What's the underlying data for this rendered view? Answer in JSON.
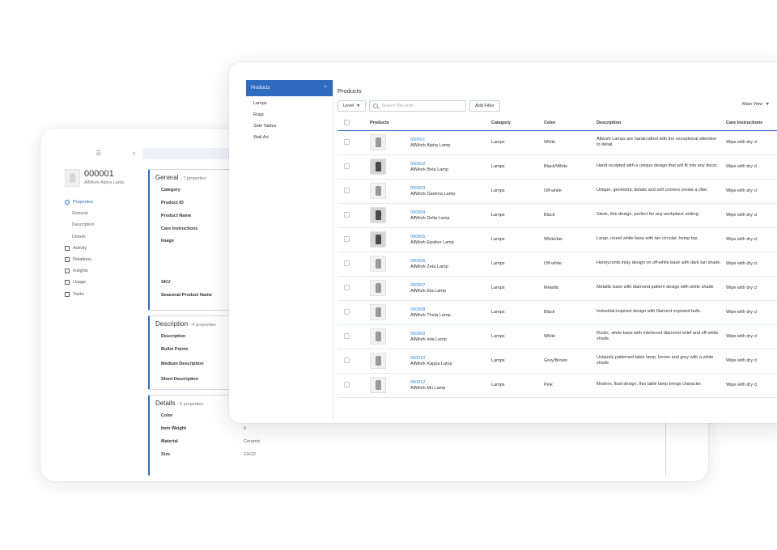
{
  "back_window": {
    "product": {
      "id": "000001",
      "name": "AllWork Alpha Lamp"
    },
    "nav": [
      {
        "label": "Properties",
        "icon": "properties-icon",
        "active": true,
        "sub": false
      },
      {
        "label": "General",
        "sub": true
      },
      {
        "label": "Description",
        "sub": true
      },
      {
        "label": "Details",
        "sub": true
      },
      {
        "label": "Activity",
        "icon": "activity-icon",
        "sub": false
      },
      {
        "label": "Relations",
        "icon": "relations-icon",
        "sub": false
      },
      {
        "label": "Insights",
        "icon": "insights-icon",
        "sub": false
      },
      {
        "label": "Usage",
        "icon": "usage-icon",
        "sub": false
      },
      {
        "label": "Tasks",
        "icon": "tasks-icon",
        "sub": false
      }
    ],
    "sections": {
      "general": {
        "title": "General",
        "count": "- 7 properties",
        "rows": [
          "Category",
          "Product ID",
          "Product Name",
          "Care Instructions",
          "Image",
          "SKU",
          "Seasonal Product Name"
        ]
      },
      "description": {
        "title": "Description",
        "count": "- 4 properties",
        "rows": [
          "Description",
          "Bullet Points",
          "Medium Description",
          "Short Description"
        ]
      },
      "details": {
        "title": "Details",
        "count": "- 5 properties",
        "rows": [
          {
            "label": "Color",
            "value": ""
          },
          {
            "label": "Item Weight",
            "value": "6"
          },
          {
            "label": "Material",
            "value": "Ceramic"
          },
          {
            "label": "Size",
            "value": "12x12"
          }
        ]
      }
    }
  },
  "front_window": {
    "sidebar": {
      "header": "Products",
      "items": [
        "Lamps",
        "Rugs",
        "Side Tables",
        "Wall Art"
      ]
    },
    "content": {
      "title": "Products",
      "level_button": "Level",
      "search_placeholder": "Search Records",
      "add_filter": "Add Filter",
      "main_view": "Main View"
    },
    "table": {
      "headers": [
        "Products",
        "Category",
        "Color",
        "Description",
        "Care Instructions"
      ],
      "rows": [
        {
          "id": "000001",
          "name": "AllWork Alpha Lamp",
          "category": "Lamps",
          "color": "White",
          "description": "Allwork Lamps are handcrafted with the exceptional attention to detail.",
          "care": "Wipe with dry cl",
          "dark": false
        },
        {
          "id": "000002",
          "name": "AllWork Beta Lamp",
          "category": "Lamps",
          "color": "Black/White",
          "description": "Hand-sculpted with a unique design that will fit into any decor.",
          "care": "Wipe with dry cl",
          "dark": true
        },
        {
          "id": "000003",
          "name": "AllWork Gamma Lamp",
          "category": "Lamps",
          "color": "Off-white",
          "description": "Unique, geometric details and soft corners create a vibe.",
          "care": "Wipe with dry cl",
          "dark": false
        },
        {
          "id": "000004",
          "name": "AllWork Delta Lamp",
          "category": "Lamps",
          "color": "Black",
          "description": "Sleek, thin design, perfect for any workplace setting.",
          "care": "Wipe with dry cl",
          "dark": true
        },
        {
          "id": "000005",
          "name": "AllWork Epsilon Lamp",
          "category": "Lamps",
          "color": "White/tan",
          "description": "Large, round white base with tan circular, hemp top.",
          "care": "Wipe with dry cl",
          "dark": true
        },
        {
          "id": "000006",
          "name": "AllWork Zeta Lamp",
          "category": "Lamps",
          "color": "Off-white",
          "description": "Honeycomb inlay design on off-white base with dark tan shade.",
          "care": "Wipe with dry cl",
          "dark": false
        },
        {
          "id": "000007",
          "name": "AllWork Eta Lamp",
          "category": "Lamps",
          "color": "Metallic",
          "description": "Metallic base with diamond pattern design with white shade",
          "care": "Wipe with dry cl",
          "dark": false
        },
        {
          "id": "000008",
          "name": "AllWork Theta Lamp",
          "category": "Lamps",
          "color": "Black",
          "description": "Industrial-inspired design with filament exposed bulb.",
          "care": "Wipe with dry cl",
          "dark": false
        },
        {
          "id": "000009",
          "name": "AllWork Iota Lamp",
          "category": "Lamps",
          "color": "White",
          "description": "Rustic, white base with interleced diamond relief and off-white shade.",
          "care": "Wipe with dry cl",
          "dark": false
        },
        {
          "id": "000010",
          "name": "AllWork Kappa Lamp",
          "category": "Lamps",
          "color": "Grey/Brown",
          "description": "Uniquely patterned table lamp, brown and grey with a white shade",
          "care": "Wipe with dry cl",
          "dark": false
        },
        {
          "id": "000012",
          "name": "AllWork Mu Lamp",
          "category": "Lamps",
          "color": "Pink",
          "description": "Modern, fluid design, this table lamp brings character.",
          "care": "Wipe with dry cl",
          "dark": false
        }
      ]
    }
  },
  "colors": {
    "accent": "#2f6bbf",
    "link": "#2f8fd6"
  }
}
